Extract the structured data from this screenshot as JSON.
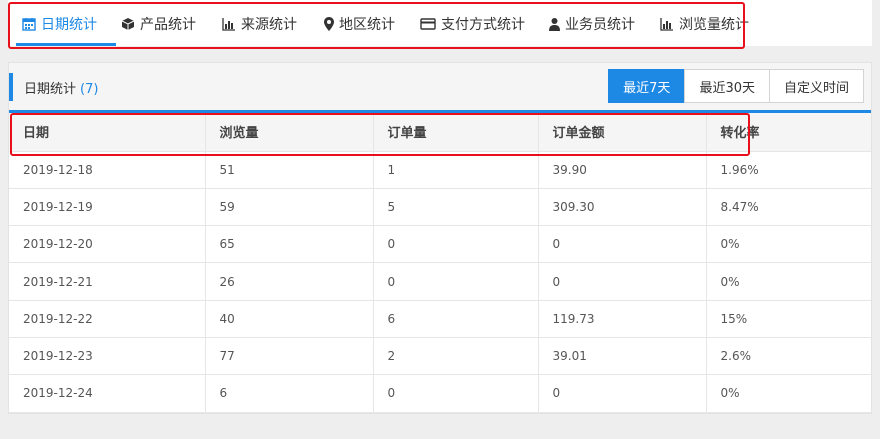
{
  "tabs": [
    {
      "label": "日期统计",
      "icon": "calendar-icon",
      "active": true
    },
    {
      "label": "产品统计",
      "icon": "cube-icon"
    },
    {
      "label": "来源统计",
      "icon": "bar-chart-icon"
    },
    {
      "label": "地区统计",
      "icon": "map-marker-icon"
    },
    {
      "label": "支付方式统计",
      "icon": "credit-card-icon"
    },
    {
      "label": "业务员统计",
      "icon": "user-icon"
    },
    {
      "label": "浏览量统计",
      "icon": "bar-chart-icon"
    }
  ],
  "panel": {
    "title": "日期统计",
    "count": "(7)"
  },
  "range": {
    "last7": "最近7天",
    "last30": "最近30天",
    "custom": "自定义时间"
  },
  "colors": {
    "accent": "#1e88e5",
    "highlight": "#e8101a"
  },
  "table": {
    "headers": [
      "日期",
      "浏览量",
      "订单量",
      "订单金额",
      "转化率"
    ],
    "rows": [
      [
        "2019-12-18",
        "51",
        "1",
        "39.90",
        "1.96%"
      ],
      [
        "2019-12-19",
        "59",
        "5",
        "309.30",
        "8.47%"
      ],
      [
        "2019-12-20",
        "65",
        "0",
        "0",
        "0%"
      ],
      [
        "2019-12-21",
        "26",
        "0",
        "0",
        "0%"
      ],
      [
        "2019-12-22",
        "40",
        "6",
        "119.73",
        "15%"
      ],
      [
        "2019-12-23",
        "77",
        "2",
        "39.01",
        "2.6%"
      ],
      [
        "2019-12-24",
        "6",
        "0",
        "0",
        "0%"
      ]
    ]
  }
}
